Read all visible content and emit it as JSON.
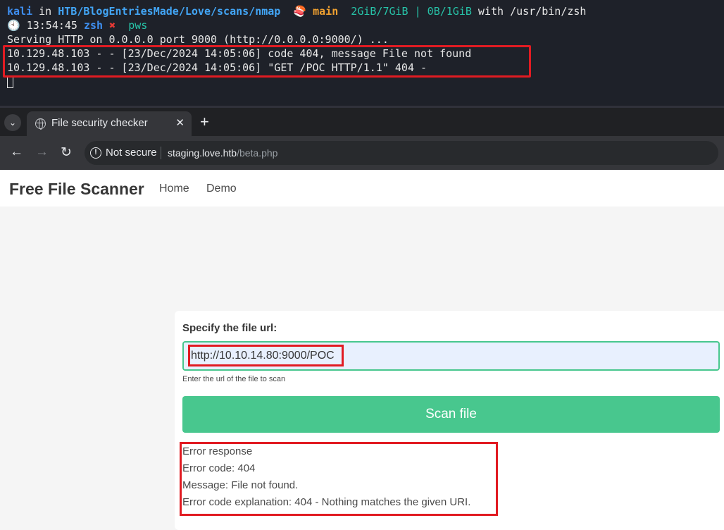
{
  "terminal": {
    "user": "kali",
    "in_word": " in ",
    "path": "HTB/BlogEntriesMade/Love/scans/nmap",
    "branch_icon": "🍣",
    "branch": " main",
    "memory": "  2GiB/7GiB | 0B/1GiB",
    "with_word": " with ",
    "shell_path": "/usr/bin/zsh",
    "clock_icon": "🕙",
    "time": " 13:54:45 ",
    "shell": "zsh",
    "error_mark": " ✖ ",
    "command": " pws",
    "lines": [
      "Serving HTTP on 0.0.0.0 port 9000 (http://0.0.0.0:9000/) ...",
      "10.129.48.103 - - [23/Dec/2024 14:05:06] code 404, message File not found",
      "10.129.48.103 - - [23/Dec/2024 14:05:06] \"GET /POC HTTP/1.1\" 404 -"
    ]
  },
  "browser": {
    "tab_menu_icon": "⌄",
    "tab_title": "File security checker",
    "tab_close_icon": "✕",
    "new_tab_icon": "+",
    "back_icon": "←",
    "forward_icon": "→",
    "reload_icon": "↻",
    "security_icon": "!",
    "security_label": "Not secure",
    "url_host": "staging.love.htb",
    "url_path": "/beta.php"
  },
  "page": {
    "brand": "Free File Scanner",
    "nav": [
      "Home",
      "Demo"
    ],
    "form": {
      "label": "Specify the file url:",
      "input_value": "http://10.10.14.80:9000/POC",
      "help": "Enter the url of the file to scan",
      "button": "Scan file"
    },
    "error_lines": [
      "Error response",
      "Error code: 404",
      "Message: File not found.",
      "Error code explanation: 404 - Nothing matches the given URI."
    ]
  },
  "colors": {
    "accent_green": "#48c78e",
    "highlight_red": "#e11b22",
    "terminal_bg": "#1e2129"
  }
}
